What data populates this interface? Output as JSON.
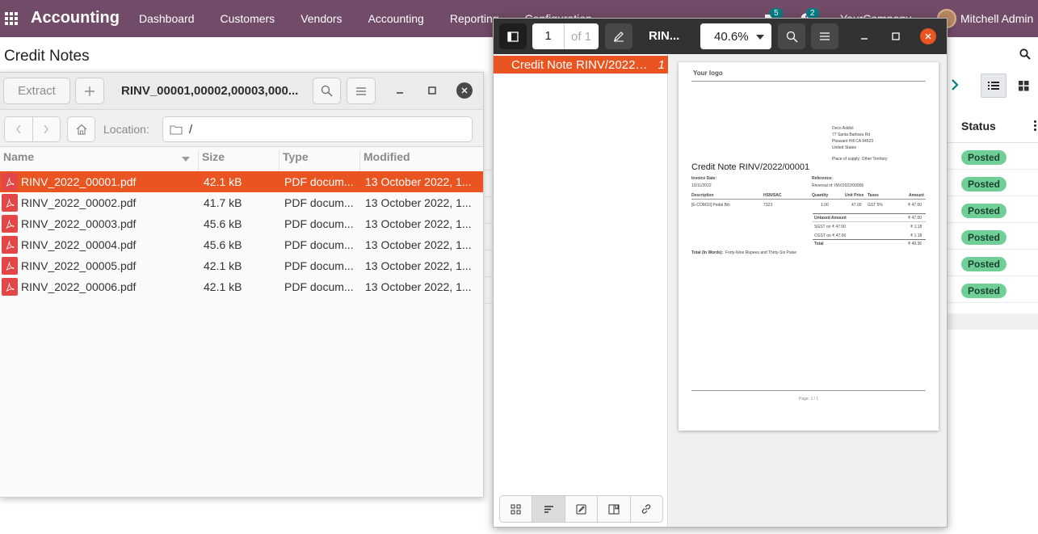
{
  "odoo": {
    "brand": "Accounting",
    "menu": [
      "Dashboard",
      "Customers",
      "Vendors",
      "Accounting",
      "Reporting",
      "Configuration"
    ],
    "chat_count": "5",
    "activity_count": "2",
    "company": "YourCompany",
    "user": "Mitchell Admin",
    "page_title": "Credit Notes",
    "status_header": "Status",
    "statuses": [
      "Posted",
      "Posted",
      "Posted",
      "Posted",
      "Posted",
      "Posted"
    ]
  },
  "archive": {
    "extract_label": "Extract",
    "title": "RINV_00001,00002,00003,000...",
    "location_label": "Location:",
    "location_value": "/",
    "columns": [
      "Name",
      "Size",
      "Type",
      "Modified"
    ],
    "files": [
      {
        "name": "RINV_2022_00001.pdf",
        "size": "42.1 kB",
        "type": "PDF docum...",
        "modified": "13 October 2022, 1..."
      },
      {
        "name": "RINV_2022_00002.pdf",
        "size": "41.7 kB",
        "type": "PDF docum...",
        "modified": "13 October 2022, 1..."
      },
      {
        "name": "RINV_2022_00003.pdf",
        "size": "45.6 kB",
        "type": "PDF docum...",
        "modified": "13 October 2022, 1..."
      },
      {
        "name": "RINV_2022_00004.pdf",
        "size": "45.6 kB",
        "type": "PDF docum...",
        "modified": "13 October 2022, 1..."
      },
      {
        "name": "RINV_2022_00005.pdf",
        "size": "42.1 kB",
        "type": "PDF docum...",
        "modified": "13 October 2022, 1..."
      },
      {
        "name": "RINV_2022_00006.pdf",
        "size": "42.1 kB",
        "type": "PDF docum...",
        "modified": "13 October 2022, 1..."
      }
    ]
  },
  "viewer": {
    "page_number": "1",
    "page_of": "of 1",
    "title": "RIN...",
    "zoom": "40.6%",
    "outline_item": "Credit Note RINV/2022/00001",
    "outline_page": "1",
    "doc": {
      "logo": "Your logo",
      "addr1": "Deco Addict",
      "addr2": "77 Santa Barbara Rd",
      "addr3": "Pleasant Hill CA 94523",
      "addr4": "United States",
      "supply": "Place of supply: Other Territory",
      "title": "Credit Note RINV/2022/00001",
      "invoice_date_label": "Invoice Date:",
      "invoice_date": "10/11/2022",
      "reference_label": "Reference:",
      "reference": "Reversal of: INV/2022/00006",
      "col_description": "Description",
      "col_hsn": "HSN/SAC",
      "col_quantity": "Quantity",
      "col_unit_price": "Unit Price",
      "col_taxes": "Taxes",
      "col_amount": "Amount",
      "line_description": "[E-COM10] Pedal Bin",
      "line_hsn": "7323",
      "line_qty": "1.00",
      "line_price": "47.00",
      "line_taxes": "GST 5%",
      "line_amount": "₹ 47.00",
      "untaxed_label": "Untaxed Amount",
      "untaxed_value": "₹ 47.00",
      "sgst_label": "SGST on ₹ 47.00",
      "sgst_value": "₹ 1.18",
      "cgst_label": "CGST on ₹ 47.00",
      "cgst_value": "₹ 1.18",
      "total_label": "Total",
      "total_value": "₹ 49.36",
      "words_label": "Total (In Words):",
      "words_value": "Forty-Nine Rupees and Thirty-Six Paise",
      "footer": "Page: 1 / 1"
    }
  }
}
